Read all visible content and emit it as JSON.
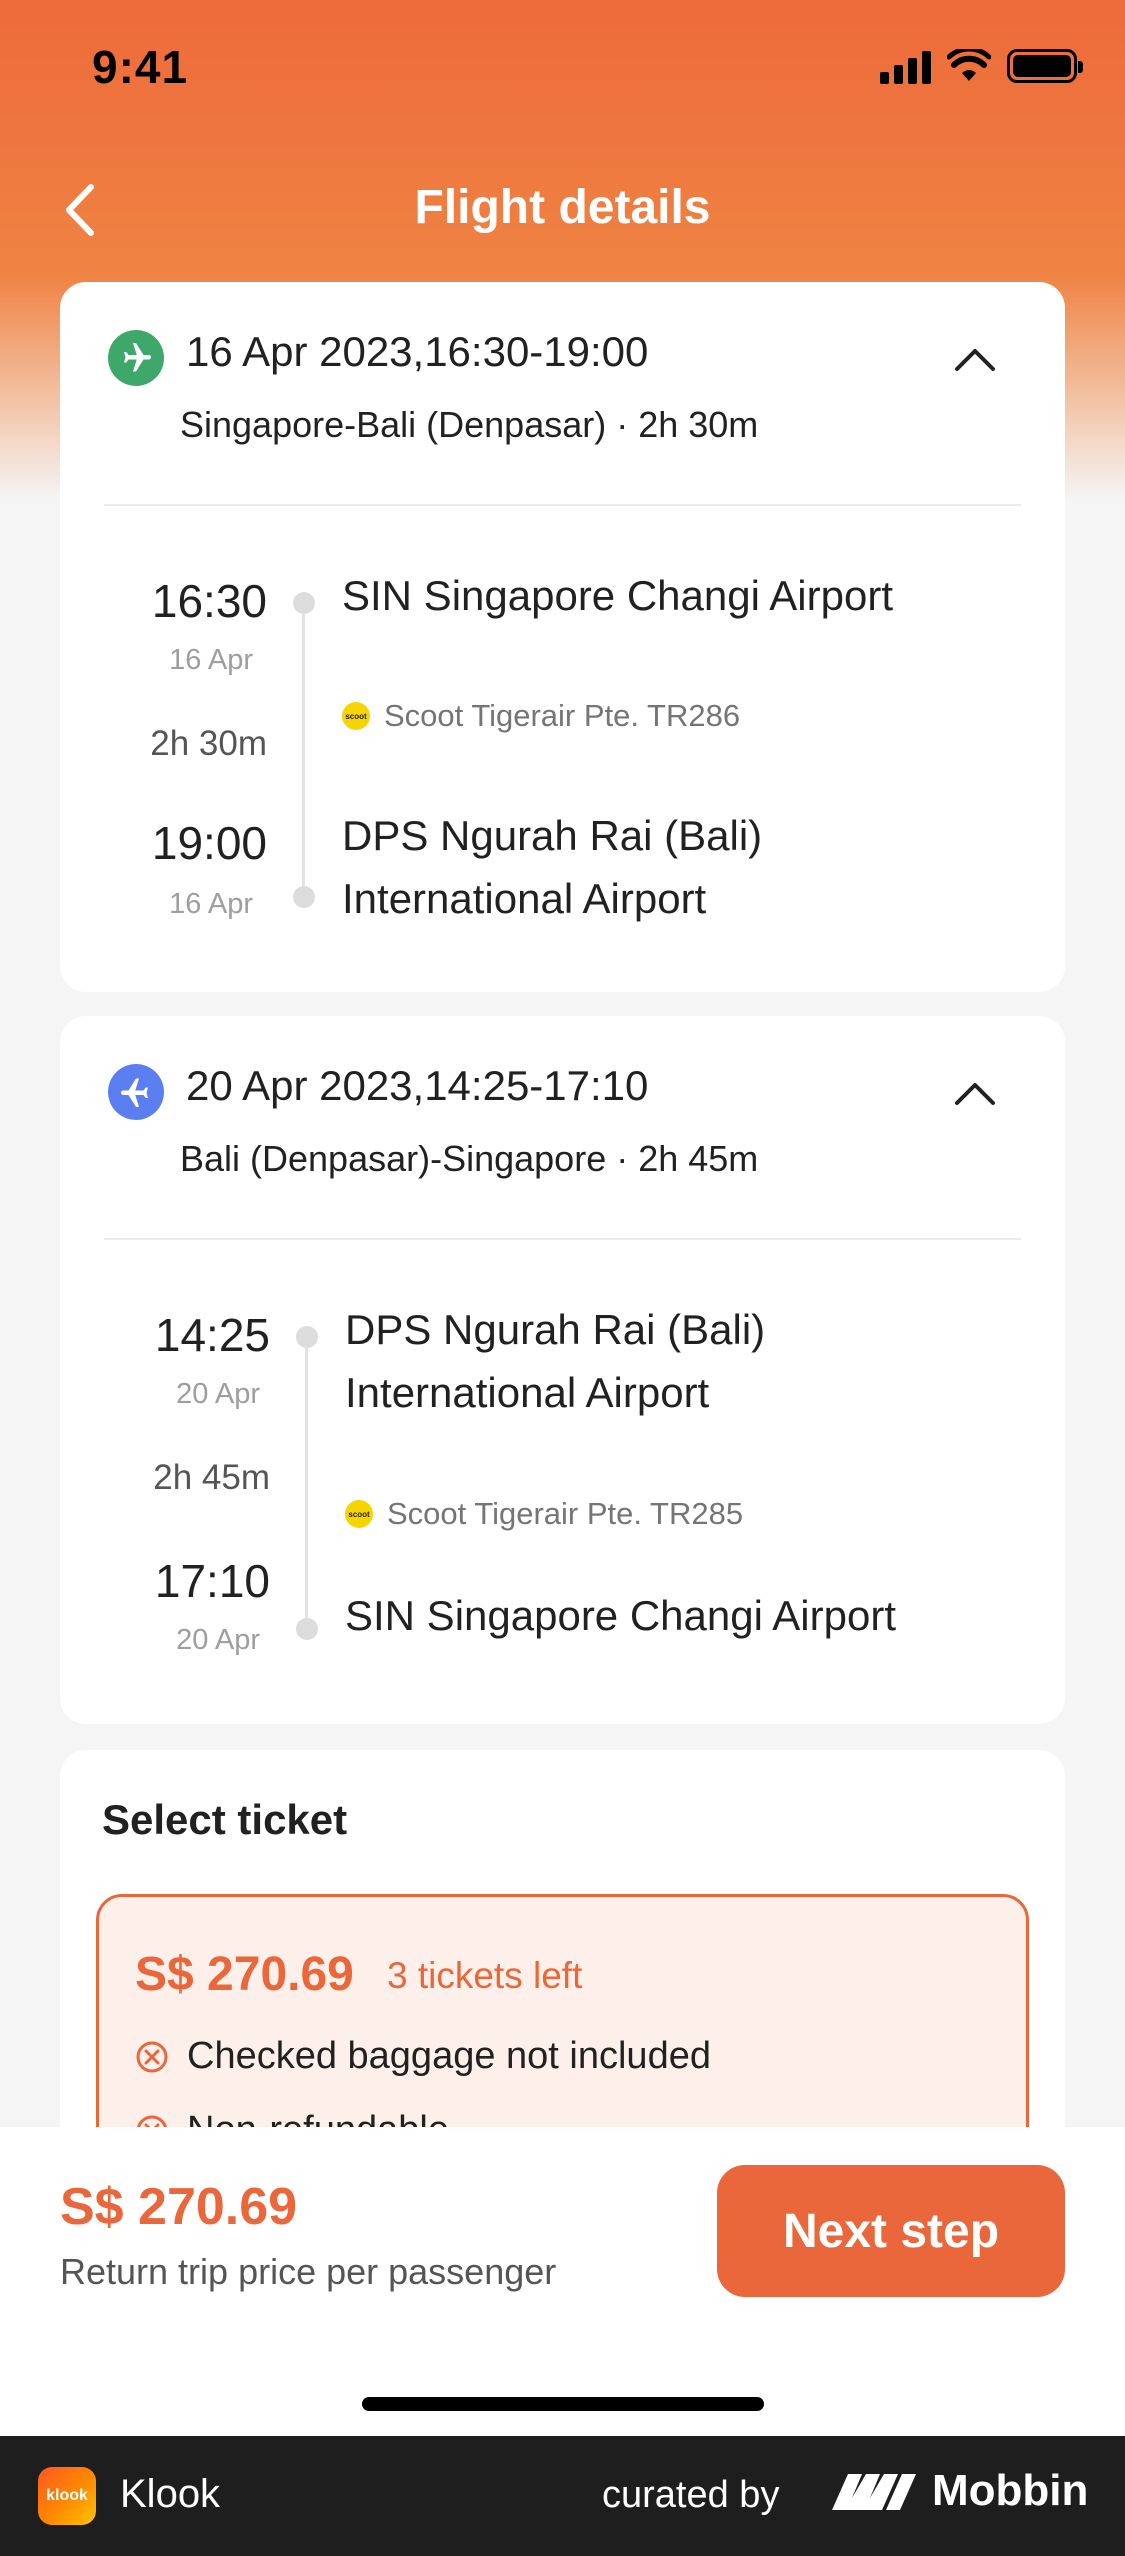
{
  "status_bar": {
    "time": "9:41"
  },
  "nav": {
    "title": "Flight details"
  },
  "outbound": {
    "date_time": "16 Apr 2023,16:30-19:00",
    "route_summary": "Singapore-Bali (Denpasar) · 2h 30m",
    "departure_time": "16:30",
    "departure_date": "16 Apr",
    "duration": "2h 30m",
    "arrival_time": "19:00",
    "arrival_date": "16 Apr",
    "origin_airport": "SIN Singapore Changi Airport",
    "airline": "Scoot Tigerair Pte. TR286",
    "destination_airport_line1": "DPS Ngurah Rai (Bali)",
    "destination_airport_line2": "International Airport",
    "badge_color": "#3ea86b"
  },
  "inbound": {
    "date_time": "20 Apr 2023,14:25-17:10",
    "route_summary": "Bali (Denpasar)-Singapore · 2h 45m",
    "departure_time": "14:25",
    "departure_date": "20 Apr",
    "duration": "2h 45m",
    "arrival_time": "17:10",
    "arrival_date": "20 Apr",
    "origin_airport_line1": "DPS Ngurah Rai (Bali)",
    "origin_airport_line2": "International Airport",
    "airline": "Scoot Tigerair Pte. TR285",
    "destination_airport": "SIN Singapore Changi Airport",
    "badge_color": "#5b7ff0"
  },
  "ticket": {
    "section_title": "Select ticket",
    "price": "S$ 270.69",
    "availability": "3 tickets left",
    "features": [
      "Checked baggage not included",
      "Non-refundable"
    ]
  },
  "bottom": {
    "total_price": "S$ 270.69",
    "caption": "Return trip price per passenger",
    "next_label": "Next step"
  },
  "footer": {
    "app_name": "Klook",
    "curated_by": "curated by",
    "brand": "Mobbin",
    "logo_text": "klook",
    "airline_logo_text": "scoot"
  },
  "colors": {
    "accent": "#e9673a",
    "hero": "#ee6a3a"
  }
}
